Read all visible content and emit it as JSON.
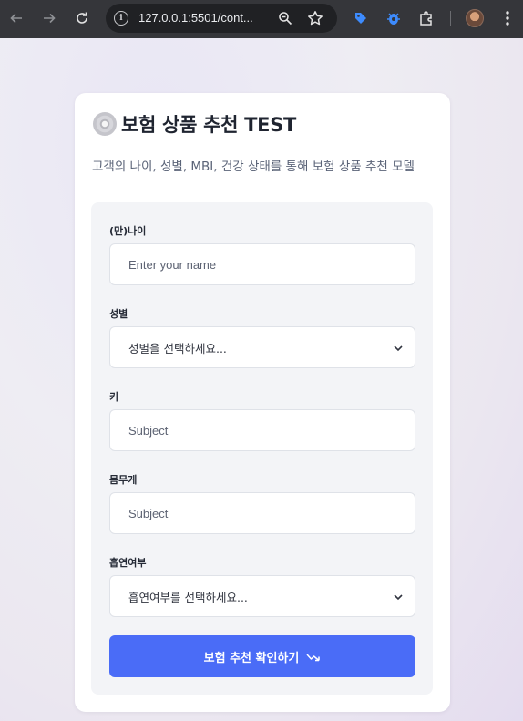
{
  "browser": {
    "url": "127.0.0.1:5501/cont..."
  },
  "page": {
    "title": "보험 상품 추천 TEST",
    "subtitle": "고객의 나이, 성별, MBI, 건강 상태를 통해 보험 상품 추천 모델"
  },
  "form": {
    "age": {
      "label": "(만)나이",
      "placeholder": "Enter your name"
    },
    "gender": {
      "label": "성별",
      "selected": "성별을 선택하세요..."
    },
    "height": {
      "label": "키",
      "placeholder": "Subject"
    },
    "weight": {
      "label": "몸무게",
      "placeholder": "Subject"
    },
    "smoking": {
      "label": "흡연여부",
      "selected": "흡연여부를 선택하세요..."
    },
    "submit_label": "보험 추천 확인하기"
  },
  "colors": {
    "accent": "#4a6cf7",
    "chrome": "#35363a"
  }
}
